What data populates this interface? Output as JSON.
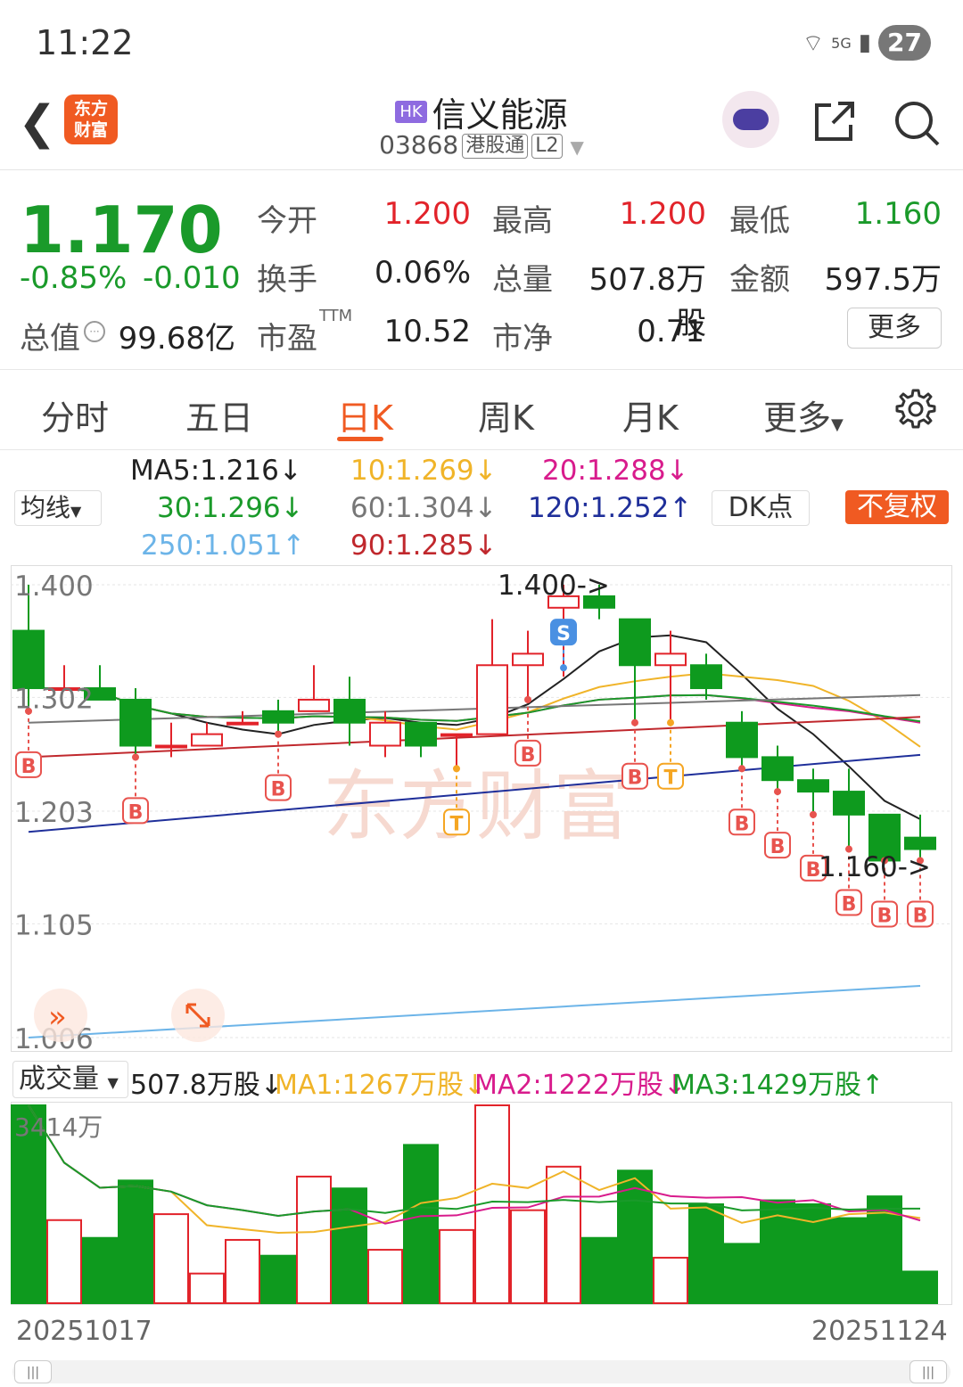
{
  "status": {
    "time": "11:22",
    "network": "5G",
    "battery": "27"
  },
  "header": {
    "market_badge": "HK",
    "name": "信义能源",
    "code": "03868",
    "connect_badge": "港股通",
    "level_badge": "L2",
    "logo_line1": "东方",
    "logo_line2": "财富"
  },
  "quote": {
    "price": "1.170",
    "change_pct": "-0.85%",
    "change": "-0.010",
    "open_label": "今开",
    "open": "1.200",
    "high_label": "最高",
    "high": "1.200",
    "low_label": "最低",
    "low": "1.160",
    "turnover_label": "换手",
    "turnover": "0.06%",
    "volume_label": "总量",
    "volume": "507.8万股",
    "amount_label": "金额",
    "amount": "597.5万",
    "mktcap_label": "总值",
    "mktcap": "99.68亿",
    "pe_label": "市盈",
    "pe_sup": "TTM",
    "pe": "10.52",
    "pb_label": "市净",
    "pb": "0.71",
    "more": "更多"
  },
  "tabs": [
    "分时",
    "五日",
    "日K",
    "周K",
    "月K",
    "更多"
  ],
  "active_tab": "日K",
  "ma_panel": {
    "selector": "均线",
    "ma5": "MA5:1.216↓",
    "ma10": "10:1.269↓",
    "ma20": "20:1.288↓",
    "ma30": "30:1.296↓",
    "ma60": "60:1.304↓",
    "ma120": "120:1.252↑",
    "ma250": "250:1.051↑",
    "ma90": "90:1.285↓",
    "dk_button": "DK点",
    "fq_button": "不复权"
  },
  "colors": {
    "up": "#e2232a",
    "down": "#0e9a1e",
    "accent": "#f05a22",
    "ma5": "#222222",
    "ma10": "#f0b429",
    "ma20": "#d81b8c",
    "ma30": "#1a9a2a",
    "ma60": "#777777",
    "ma90": "#c0282d",
    "ma120": "#1f2f9a",
    "ma250": "#6cb4e8"
  },
  "chart_labels": {
    "y_ticks": [
      "1.400",
      "1.302",
      "1.203",
      "1.105",
      "1.006"
    ],
    "high_mark": "1.400->",
    "low_mark": "1.160->",
    "watermark": "东方财富"
  },
  "volume_panel": {
    "selector": "成交量",
    "vol": "507.8万股↓",
    "ma1": "MA1:1267万股↓",
    "ma2": "MA2:1222万股↓",
    "ma3": "MA3:1429万股↑",
    "max_label": "3414万"
  },
  "dates": {
    "start": "20251017",
    "end": "20251124"
  },
  "chart_data": {
    "type": "candlestick",
    "ylim": [
      1.006,
      1.4
    ],
    "candles": [
      {
        "o": 1.36,
        "h": 1.4,
        "l": 1.29,
        "c": 1.31,
        "v": 1.0,
        "sig": "B"
      },
      {
        "o": 1.31,
        "h": 1.33,
        "l": 1.31,
        "c": 1.31,
        "v": 0.42
      },
      {
        "o": 1.31,
        "h": 1.33,
        "l": 1.3,
        "c": 1.3,
        "v": 0.33
      },
      {
        "o": 1.3,
        "h": 1.31,
        "l": 1.25,
        "c": 1.26,
        "v": 0.62,
        "sig": "B"
      },
      {
        "o": 1.26,
        "h": 1.28,
        "l": 1.25,
        "c": 1.26,
        "v": 0.45
      },
      {
        "o": 1.26,
        "h": 1.28,
        "l": 1.26,
        "c": 1.27,
        "v": 0.15
      },
      {
        "o": 1.28,
        "h": 1.29,
        "l": 1.28,
        "c": 1.28,
        "v": 0.32
      },
      {
        "o": 1.29,
        "h": 1.3,
        "l": 1.27,
        "c": 1.28,
        "v": 0.24,
        "sig": "B"
      },
      {
        "o": 1.29,
        "h": 1.33,
        "l": 1.29,
        "c": 1.3,
        "v": 0.64
      },
      {
        "o": 1.3,
        "h": 1.32,
        "l": 1.26,
        "c": 1.28,
        "v": 0.58
      },
      {
        "o": 1.26,
        "h": 1.29,
        "l": 1.25,
        "c": 1.28,
        "v": 0.27
      },
      {
        "o": 1.28,
        "h": 1.28,
        "l": 1.25,
        "c": 1.26,
        "v": 0.8
      },
      {
        "o": 1.27,
        "h": 1.27,
        "l": 1.24,
        "c": 1.27,
        "v": 0.37,
        "sig": "T"
      },
      {
        "o": 1.27,
        "h": 1.37,
        "l": 1.27,
        "c": 1.33,
        "v": 1.0
      },
      {
        "o": 1.33,
        "h": 1.36,
        "l": 1.3,
        "c": 1.34,
        "v": 0.47,
        "sig": "B"
      },
      {
        "o": 1.38,
        "h": 1.4,
        "l": 1.32,
        "c": 1.39,
        "v": 0.69,
        "sig": "S"
      },
      {
        "o": 1.39,
        "h": 1.4,
        "l": 1.37,
        "c": 1.38,
        "v": 0.33
      },
      {
        "o": 1.37,
        "h": 1.37,
        "l": 1.28,
        "c": 1.33,
        "v": 0.67,
        "sig": "B"
      },
      {
        "o": 1.33,
        "h": 1.36,
        "l": 1.28,
        "c": 1.34,
        "v": 0.23,
        "sig": "T"
      },
      {
        "o": 1.33,
        "h": 1.34,
        "l": 1.3,
        "c": 1.31,
        "v": 0.5
      },
      {
        "o": 1.28,
        "h": 1.29,
        "l": 1.24,
        "c": 1.25,
        "v": 0.3,
        "sig": "B"
      },
      {
        "o": 1.25,
        "h": 1.26,
        "l": 1.22,
        "c": 1.23,
        "v": 0.52,
        "sig": "B"
      },
      {
        "o": 1.23,
        "h": 1.24,
        "l": 1.2,
        "c": 1.22,
        "v": 0.5,
        "sig": "B"
      },
      {
        "o": 1.22,
        "h": 1.24,
        "l": 1.17,
        "c": 1.2,
        "v": 0.43,
        "sig": "B"
      },
      {
        "o": 1.2,
        "h": 1.2,
        "l": 1.16,
        "c": 1.16,
        "v": 0.54,
        "sig": "B"
      },
      {
        "o": 1.18,
        "h": 1.2,
        "l": 1.16,
        "c": 1.17,
        "v": 0.16,
        "sig": "B"
      }
    ]
  }
}
